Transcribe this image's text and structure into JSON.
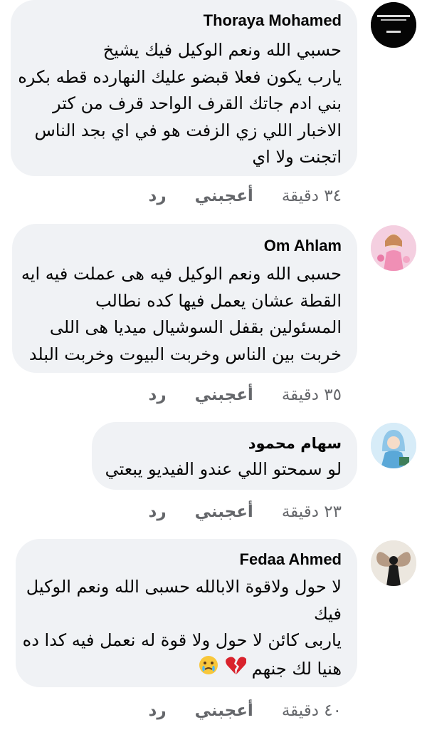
{
  "comments": [
    {
      "author": "Thoraya Mohamed",
      "lines": [
        "حسبي الله ونعم الوكيل فيك يشيخ",
        "يارب يكون فعلا قبضو عليك النهارده قطه بكره",
        "بني ادم جاتك القرف الواحد قرف من كتر",
        "الاخبار اللي زي الزفت هو في اي بجد الناس",
        "اتجنت ولا اي"
      ],
      "time": "٣٤ دقيقة",
      "like": "أعجبني",
      "reply": "رد",
      "avatar_text": "إنا لله وإنا إليه راجعون البقاء لله"
    },
    {
      "author": "Om Ahlam",
      "lines": [
        "حسبى الله ونعم الوكيل فيه هى عملت فيه ايه",
        "القطة عشان يعمل فيها كده نطالب",
        "المسئولين بقفل السوشيال ميديا هى اللى",
        "خربت بين الناس وخربت البيوت وخربت البلد"
      ],
      "time": "٣٥ دقيقة",
      "like": "أعجبني",
      "reply": "رد"
    },
    {
      "author": "سهام  محمود",
      "lines": [
        "لو سمحتو اللي عندو الفيديو يبعتي"
      ],
      "time": "٢٣ دقيقة",
      "like": "أعجبني",
      "reply": "رد"
    },
    {
      "author": "Fedaa Ahmed",
      "lines": [
        "لا حول ولاقوة الابالله  حسبى الله ونعم الوكيل",
        "فيك",
        "ياربى  كائن لا حول ولا قوة له نعمل فيه كدا ده",
        "هنيا لك جنهم"
      ],
      "time": "٤٠ دقيقة",
      "like": "أعجبني",
      "reply": "رد",
      "emojis": [
        "broken-heart-icon",
        "crying-face-icon"
      ]
    }
  ]
}
